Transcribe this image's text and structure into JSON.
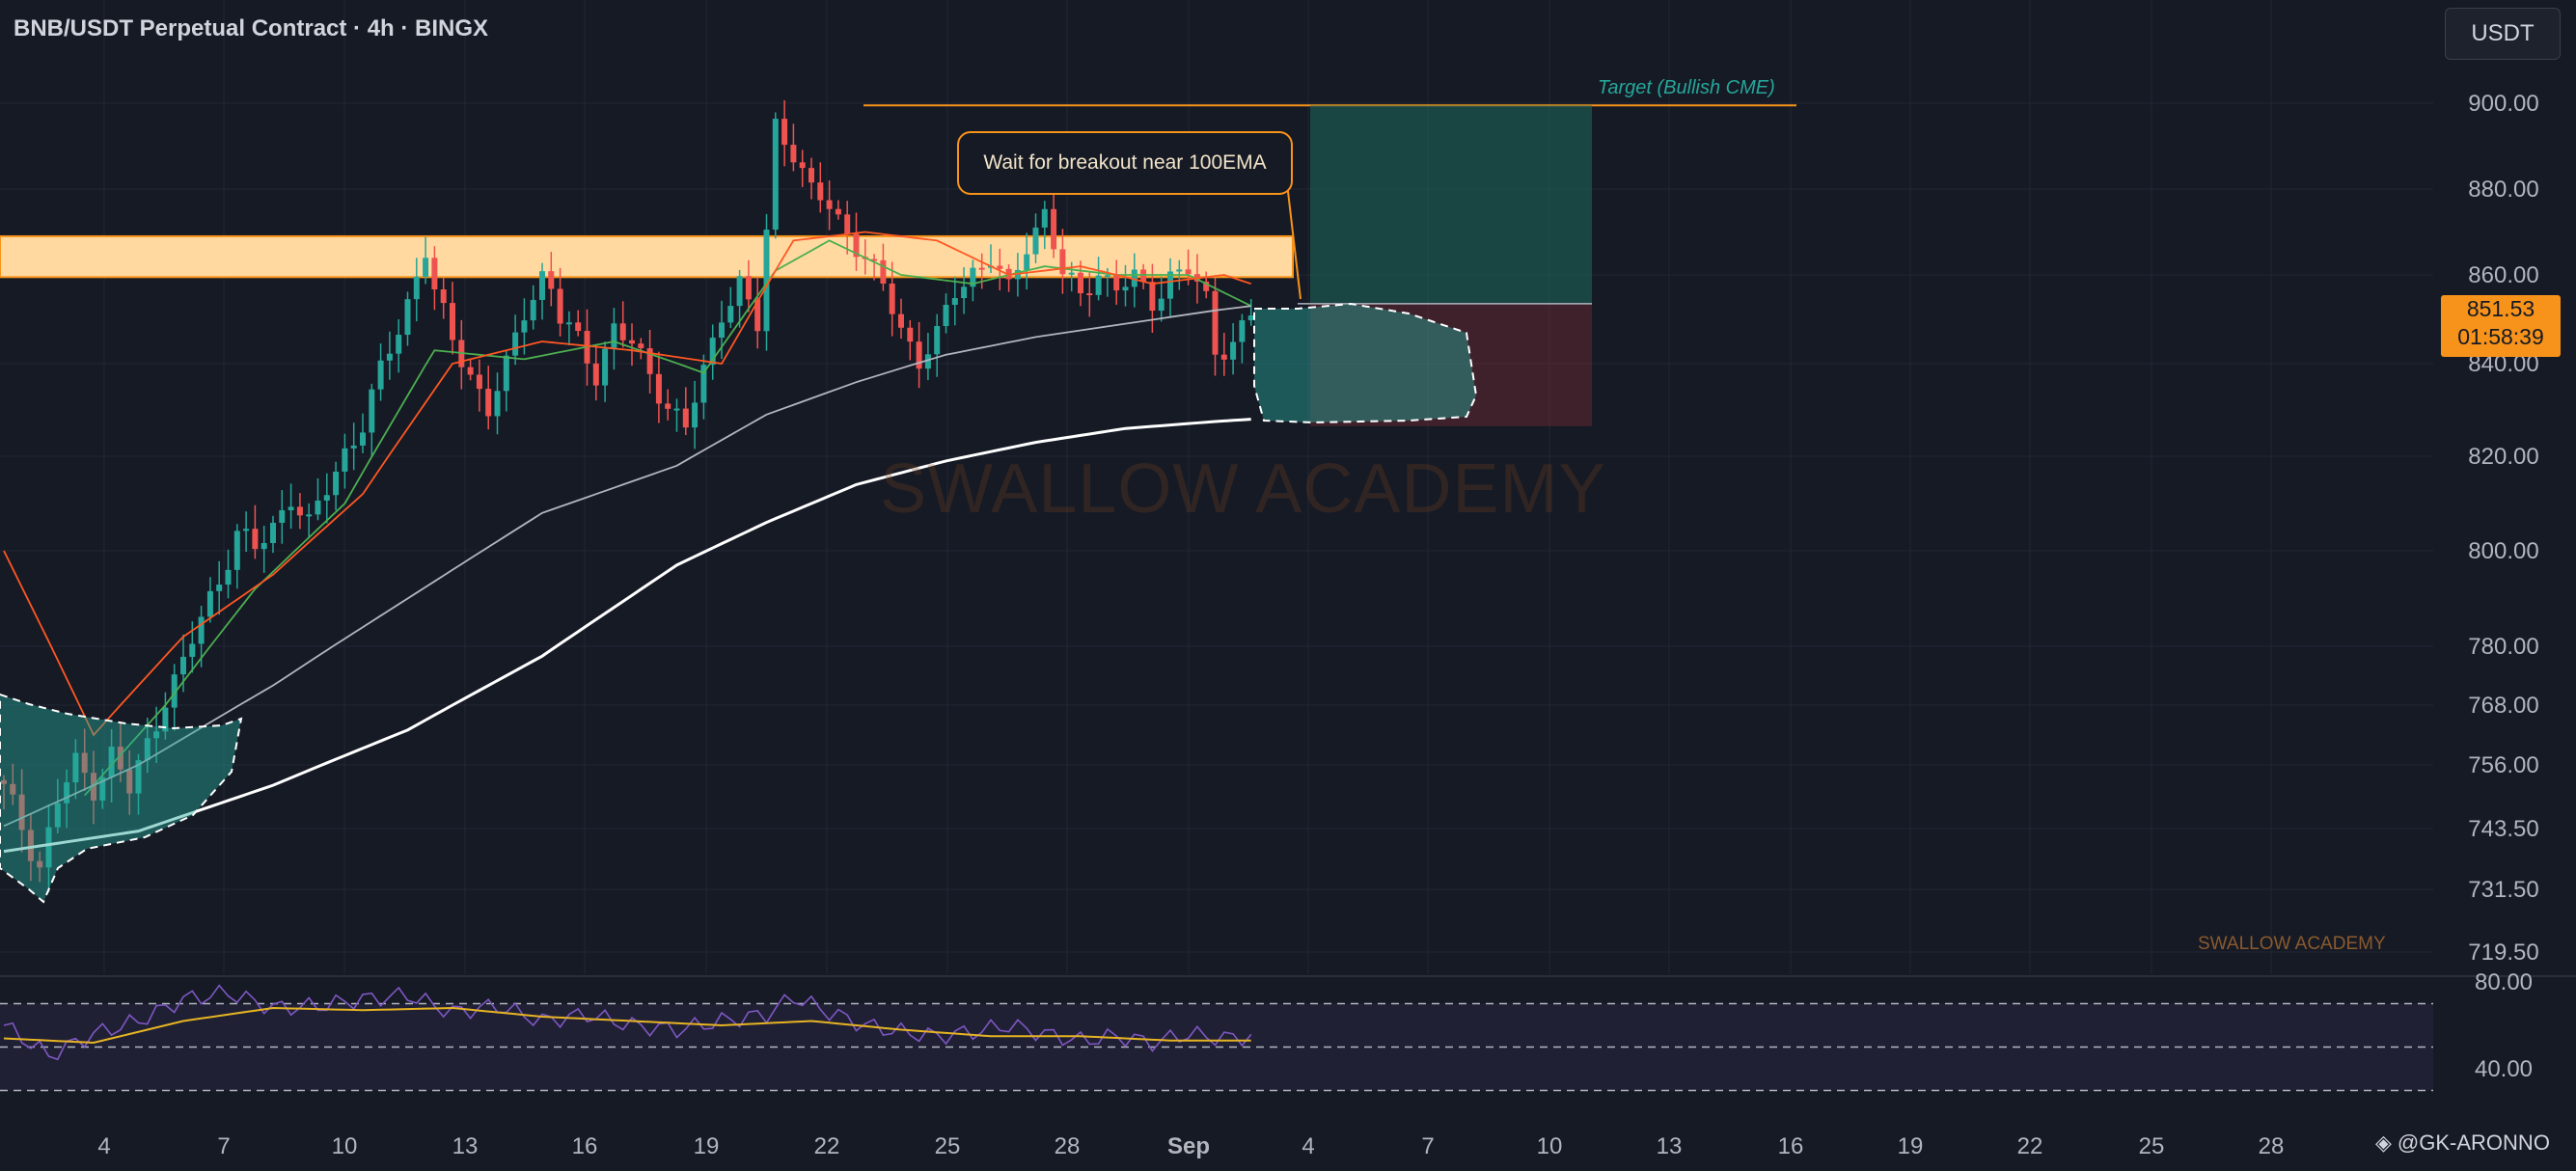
{
  "header": {
    "title": "BNB/USDT Perpetual Contract · 4h · BINGX",
    "currency_button": "USDT"
  },
  "last_price": {
    "value": "851.53",
    "countdown": "01:58:39"
  },
  "annotations": {
    "callout": "Wait for breakout near 100EMA",
    "target": "Target (Bullish CME)",
    "watermark_big": "SWALLOW ACADEMY",
    "watermark_small": "SWALLOW ACADEMY",
    "signature": "@GK-ARONNO"
  },
  "colors": {
    "up": "#26a69a",
    "down": "#ef5350",
    "zone": "#ffd9a0",
    "accent": "#f7931a",
    "rsi": "#7e57c2",
    "rsi_ma": "#e6b422"
  },
  "chart_data": {
    "type": "candlestick",
    "x_ticks": [
      "4",
      "7",
      "10",
      "13",
      "16",
      "19",
      "22",
      "25",
      "28",
      "Sep",
      "4",
      "7",
      "10",
      "13",
      "16",
      "19",
      "22",
      "25",
      "28"
    ],
    "y_ticks": [
      "900.00",
      "880.00",
      "860.00",
      "840.00",
      "820.00",
      "800.00",
      "780.00",
      "768.00",
      "756.00",
      "743.50",
      "731.50",
      "719.50"
    ],
    "y_ticks_rsi": [
      "80.00",
      "40.00"
    ],
    "key_levels": {
      "resistance_zone": [
        859.5,
        869.0
      ],
      "target": 899.5,
      "entry": 853.5,
      "stop": 826.5,
      "current": 851.53
    },
    "close_anchors": [
      [
        0,
        751
      ],
      [
        2,
        744
      ],
      [
        4,
        736
      ],
      [
        6,
        749
      ],
      [
        8,
        756
      ],
      [
        10,
        752
      ],
      [
        12,
        758
      ],
      [
        14,
        751
      ],
      [
        16,
        760
      ],
      [
        18,
        770
      ],
      [
        20,
        776
      ],
      [
        22,
        786
      ],
      [
        24,
        794
      ],
      [
        26,
        804
      ],
      [
        28,
        800
      ],
      [
        30,
        805
      ],
      [
        32,
        812
      ],
      [
        34,
        805
      ],
      [
        36,
        813
      ],
      [
        38,
        821
      ],
      [
        40,
        827
      ],
      [
        42,
        838
      ],
      [
        44,
        848
      ],
      [
        46,
        860
      ],
      [
        47,
        866
      ],
      [
        48,
        856
      ],
      [
        50,
        845
      ],
      [
        52,
        838
      ],
      [
        54,
        830
      ],
      [
        56,
        839
      ],
      [
        58,
        852
      ],
      [
        60,
        860
      ],
      [
        61,
        857
      ],
      [
        62,
        850
      ],
      [
        64,
        845
      ],
      [
        66,
        838
      ],
      [
        68,
        848
      ],
      [
        70,
        844
      ],
      [
        72,
        838
      ],
      [
        74,
        831
      ],
      [
        76,
        826
      ],
      [
        78,
        838
      ],
      [
        80,
        852
      ],
      [
        82,
        858
      ],
      [
        84,
        848
      ],
      [
        85,
        870
      ],
      [
        86,
        895
      ],
      [
        88,
        889
      ],
      [
        90,
        879
      ],
      [
        92,
        876
      ],
      [
        94,
        870
      ],
      [
        96,
        864
      ],
      [
        98,
        857
      ],
      [
        100,
        848
      ],
      [
        102,
        841
      ],
      [
        104,
        846
      ],
      [
        106,
        856
      ],
      [
        108,
        861
      ],
      [
        110,
        864
      ],
      [
        112,
        856
      ],
      [
        114,
        867
      ],
      [
        116,
        875
      ],
      [
        118,
        860
      ],
      [
        120,
        855
      ],
      [
        122,
        861
      ],
      [
        124,
        857
      ],
      [
        126,
        859
      ],
      [
        128,
        854
      ],
      [
        130,
        860
      ],
      [
        132,
        861
      ],
      [
        134,
        854
      ],
      [
        135,
        843
      ],
      [
        137,
        845
      ],
      [
        139,
        851
      ]
    ],
    "moving_averages": [
      {
        "name": "",
        "color": "#4caf50",
        "anchors": [
          [
            9,
            750
          ],
          [
            18,
            768
          ],
          [
            28,
            792
          ],
          [
            38,
            810
          ],
          [
            48,
            843
          ],
          [
            58,
            841
          ],
          [
            68,
            845
          ],
          [
            78,
            838
          ],
          [
            86,
            861
          ],
          [
            92,
            868
          ],
          [
            100,
            860
          ],
          [
            108,
            858
          ],
          [
            116,
            862
          ],
          [
            124,
            860
          ],
          [
            132,
            860
          ],
          [
            139,
            853
          ]
        ]
      },
      {
        "name": "",
        "color": "#ff5722",
        "anchors": [
          [
            0,
            800
          ],
          [
            10,
            762
          ],
          [
            20,
            782
          ],
          [
            30,
            795
          ],
          [
            40,
            812
          ],
          [
            50,
            840
          ],
          [
            60,
            845
          ],
          [
            70,
            843
          ],
          [
            80,
            840
          ],
          [
            88,
            868
          ],
          [
            96,
            870
          ],
          [
            104,
            868
          ],
          [
            112,
            860
          ],
          [
            120,
            862
          ],
          [
            128,
            858
          ],
          [
            136,
            860
          ],
          [
            139,
            858
          ]
        ]
      },
      {
        "name": "",
        "color": "#b2b5be",
        "anchors": [
          [
            0,
            744
          ],
          [
            15,
            756
          ],
          [
            30,
            772
          ],
          [
            45,
            790
          ],
          [
            60,
            808
          ],
          [
            75,
            818
          ],
          [
            85,
            829
          ],
          [
            95,
            836
          ],
          [
            105,
            842
          ],
          [
            115,
            846
          ],
          [
            125,
            849
          ],
          [
            135,
            852
          ],
          [
            139,
            853
          ]
        ]
      },
      {
        "name": "",
        "color": "#ffffff",
        "anchors": [
          [
            0,
            739
          ],
          [
            15,
            743
          ],
          [
            30,
            752
          ],
          [
            45,
            763
          ],
          [
            60,
            778
          ],
          [
            75,
            797
          ],
          [
            85,
            806
          ],
          [
            95,
            814
          ],
          [
            105,
            819
          ],
          [
            115,
            823
          ],
          [
            125,
            826
          ],
          [
            135,
            827.5
          ],
          [
            139,
            828
          ]
        ]
      }
    ],
    "rsi": {
      "anchors": [
        [
          0,
          60
        ],
        [
          5,
          46
        ],
        [
          10,
          56
        ],
        [
          15,
          62
        ],
        [
          20,
          72
        ],
        [
          25,
          75
        ],
        [
          30,
          68
        ],
        [
          35,
          69
        ],
        [
          40,
          72
        ],
        [
          45,
          74
        ],
        [
          50,
          66
        ],
        [
          55,
          69
        ],
        [
          60,
          62
        ],
        [
          65,
          65
        ],
        [
          70,
          60
        ],
        [
          75,
          58
        ],
        [
          80,
          62
        ],
        [
          85,
          65
        ],
        [
          88,
          73
        ],
        [
          92,
          66
        ],
        [
          96,
          60
        ],
        [
          100,
          57
        ],
        [
          104,
          55
        ],
        [
          108,
          57
        ],
        [
          112,
          60
        ],
        [
          116,
          56
        ],
        [
          120,
          53
        ],
        [
          124,
          55
        ],
        [
          128,
          52
        ],
        [
          132,
          56
        ],
        [
          136,
          54
        ],
        [
          139,
          55
        ]
      ],
      "ma_anchors": [
        [
          0,
          54
        ],
        [
          10,
          52
        ],
        [
          20,
          62
        ],
        [
          30,
          68
        ],
        [
          40,
          67
        ],
        [
          50,
          68
        ],
        [
          60,
          64
        ],
        [
          70,
          62
        ],
        [
          80,
          60
        ],
        [
          90,
          62
        ],
        [
          100,
          58
        ],
        [
          110,
          55
        ],
        [
          120,
          55
        ],
        [
          130,
          53
        ],
        [
          139,
          53
        ]
      ],
      "bands": [
        70,
        50,
        30
      ]
    }
  }
}
